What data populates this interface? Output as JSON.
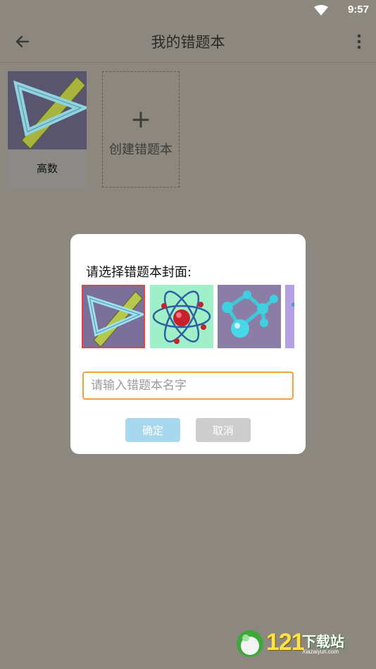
{
  "status_bar": {
    "time": "9:57"
  },
  "app_bar": {
    "title": "我的错题本"
  },
  "books": [
    {
      "label": "高数",
      "cover": "ruler-triangle"
    }
  ],
  "create_card": {
    "plus": "+",
    "label": "创建错题本"
  },
  "dialog": {
    "title": "请选择错题本封面:",
    "covers": [
      "ruler-triangle",
      "atom",
      "molecule",
      "partial-cover"
    ],
    "input_placeholder": "请输入错题本名字",
    "input_value": "",
    "ok_label": "确定",
    "cancel_label": "取消"
  },
  "watermark": {
    "number": "121",
    "text": "下载站",
    "sub": "Xiazaiyun.com"
  },
  "colors": {
    "background": "#8c8880",
    "input_border": "#f0a040",
    "ok_button": "#a7d8ee",
    "cancel_button": "#cdcdcd",
    "selected_border": "#e04545"
  }
}
